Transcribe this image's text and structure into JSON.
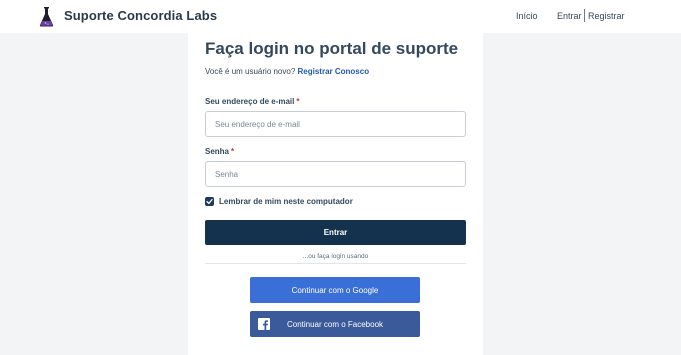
{
  "header": {
    "site_title": "Suporte Concordia Labs",
    "nav": {
      "home": "Início",
      "login": "Entrar",
      "register": "Registrar"
    }
  },
  "login": {
    "title": "Faça login no portal de suporte",
    "subtitle_prefix": "Você é um usuário novo?",
    "subtitle_link": "Registrar Conosco",
    "email_label": "Seu endereço de e-mail",
    "email_placeholder": "Seu endereço de e-mail",
    "email_value": "",
    "password_label": "Senha",
    "password_placeholder": "Senha",
    "password_value": "",
    "required_mark": "*",
    "remember_label": "Lembrar de mim neste computador",
    "remember_checked": true,
    "submit_label": "Entrar",
    "divider_text": "...ou faça login usando",
    "google_label": "Continuar com o Google",
    "facebook_label": "Continuar com o Facebook"
  },
  "colors": {
    "page_background": "#f3f4f6",
    "primary_dark": "#14324e",
    "link": "#2458b3",
    "google_button": "#3a6fd8",
    "facebook_button": "#3b5a9a",
    "required": "#c0392b"
  },
  "icons": {
    "logo": "flask-logo-icon",
    "checkbox": "check-icon",
    "facebook": "facebook-icon"
  }
}
